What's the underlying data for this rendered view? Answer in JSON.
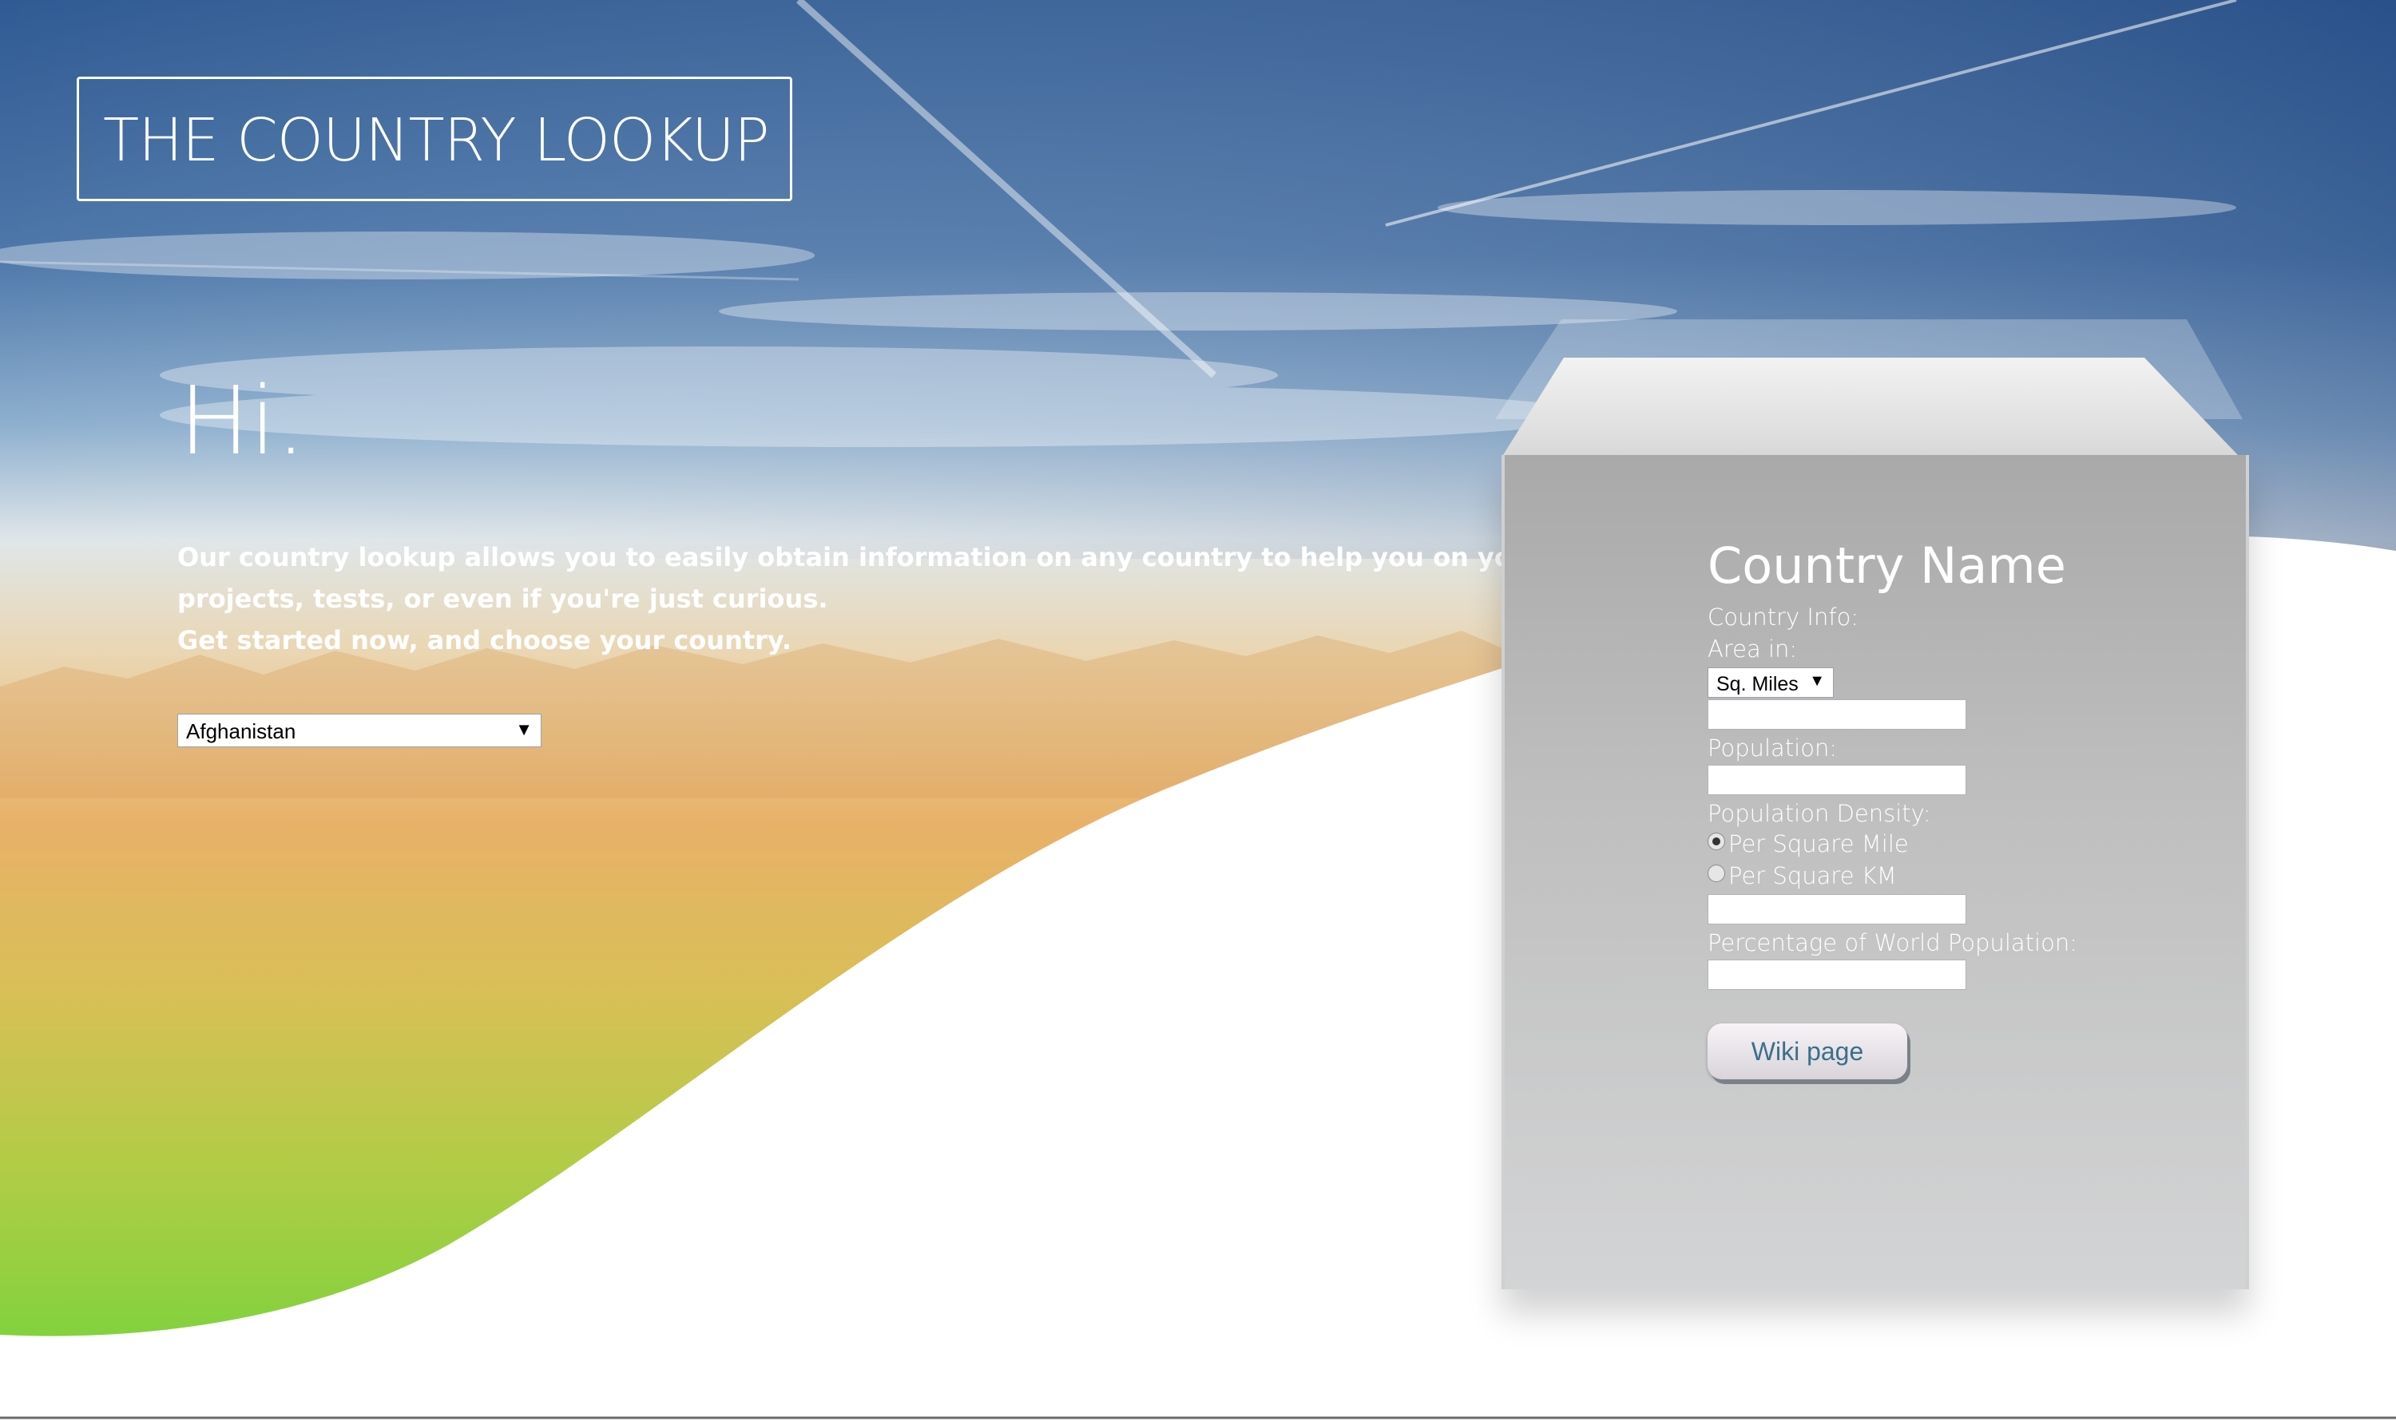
{
  "header": {
    "title": "THE COUNTRY LOOKUP"
  },
  "hero": {
    "greeting": "Hi.",
    "intro_lines": [
      "Our country lookup allows you to easily obtain information on any country to help you on your",
      "projects, tests, or even if you're just curious.",
      "Get started now, and choose your country."
    ]
  },
  "country_select": {
    "value": "Afghanistan",
    "arrow": "▼"
  },
  "panel": {
    "heading": "Country Name",
    "country_info_label": "Country Info:",
    "area_label": "Area in:",
    "area_unit": {
      "value": "Sq. Miles",
      "arrow": "▼"
    },
    "area_value": "",
    "population_label": "Population:",
    "population_value": "",
    "density_label": "Population Density:",
    "density_options": [
      {
        "label": "Per Square Mile",
        "selected": true
      },
      {
        "label": "Per Square KM",
        "selected": false
      }
    ],
    "density_value": "",
    "world_pct_label": "Percentage of World Population:",
    "world_pct_value": "",
    "wiki_button": "Wiki page"
  },
  "colors": {
    "sky_top": "#2f5a93",
    "sky_mid": "#7fa6cc",
    "haze": "#ead6b2",
    "orange": "#e8b168",
    "green": "#7fd23c",
    "box_gray": "#b7b7b7",
    "wiki_text": "#3b6f8a"
  }
}
